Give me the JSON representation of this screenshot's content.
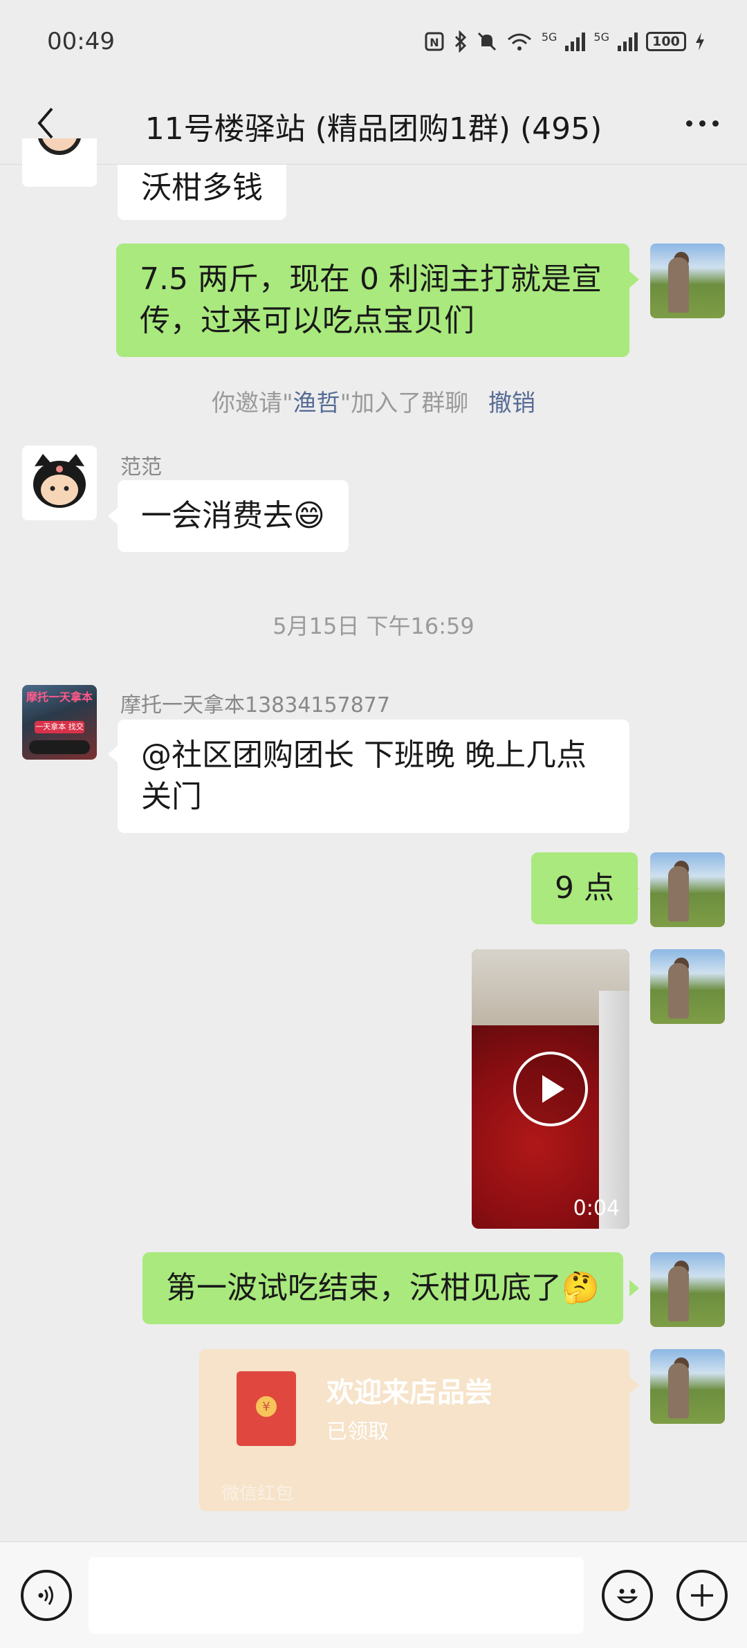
{
  "status_bar": {
    "time": "00:49",
    "net1": "5G",
    "net2": "5G",
    "wifi_label": "6",
    "battery": "100"
  },
  "header": {
    "title": "11号楼驿站 (精品团购1群) (495)"
  },
  "messages": {
    "m1_text": "沃柑多钱",
    "m2_text": "7.5 两斤，现在 0 利润主打就是宣传，过来可以吃点宝贝们",
    "sys1_prefix": "你邀请\"",
    "sys1_name": "渔哲",
    "sys1_suffix": "\"加入了群聊",
    "sys1_action": "撤销",
    "m3_sender": "范范",
    "m3_text": "一会消费去😄",
    "time_divider": "5月15日 下午16:59",
    "m4_sender": "摩托一天拿本13834157877",
    "m4_text": "@社区团购团长  下班晚  晚上几点关门",
    "m5_text": "9 点",
    "video_duration": "0:04",
    "m6_text": "第一波试吃结束，沃柑见底了🤔",
    "packet_title": "欢迎来店品尝",
    "packet_status": "已领取",
    "packet_footer": "微信红包"
  },
  "avatars": {
    "moto_caption_top": "摩托一天拿本",
    "moto_caption_bottom": "一天拿本 找交流"
  },
  "icons": {
    "back": "chevron-left-icon",
    "more": "more-dots-icon",
    "voice": "voice-icon",
    "emoji": "emoji-icon",
    "plus": "plus-icon"
  },
  "colors": {
    "outgoing_bubble": "#a9e97d",
    "incoming_bubble": "#ffffff",
    "background": "#ededed",
    "link": "#576b95",
    "red_packet": "#f6e3c9"
  }
}
